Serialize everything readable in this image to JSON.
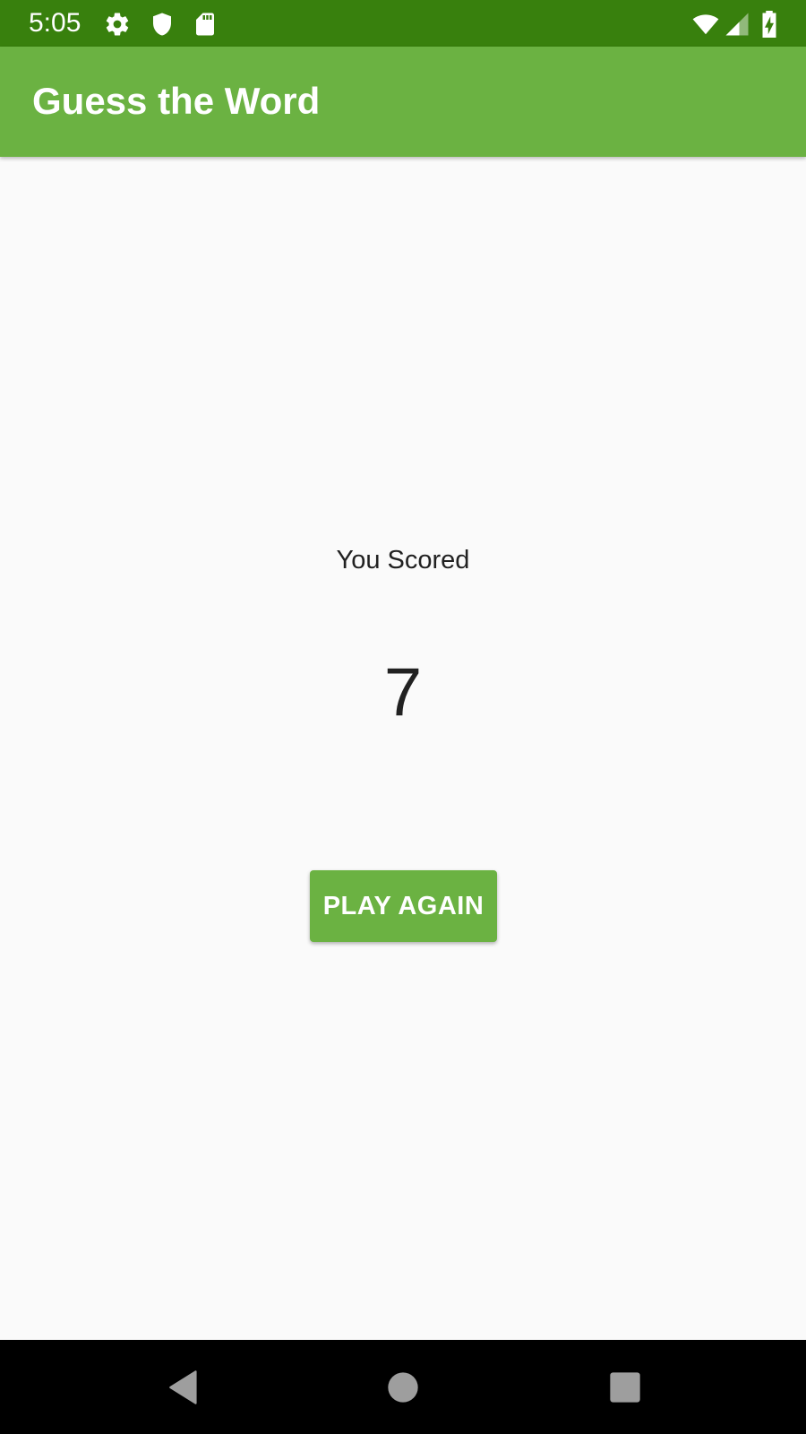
{
  "status_bar": {
    "time": "5:05",
    "icons": [
      "gear-icon",
      "shield-icon",
      "sd-card-icon",
      "wifi-icon",
      "cell-signal-icon",
      "battery-charging-icon"
    ]
  },
  "app_bar": {
    "title": "Guess the Word"
  },
  "score": {
    "label": "You Scored",
    "value": "7"
  },
  "actions": {
    "play_again_label": "PLAY AGAIN"
  },
  "nav_bar": {
    "icons": [
      "back-icon",
      "home-icon",
      "recents-icon"
    ]
  },
  "colors": {
    "status_bar": "#38800d",
    "primary": "#6bb242",
    "background": "#fafafa",
    "text": "#212121"
  }
}
